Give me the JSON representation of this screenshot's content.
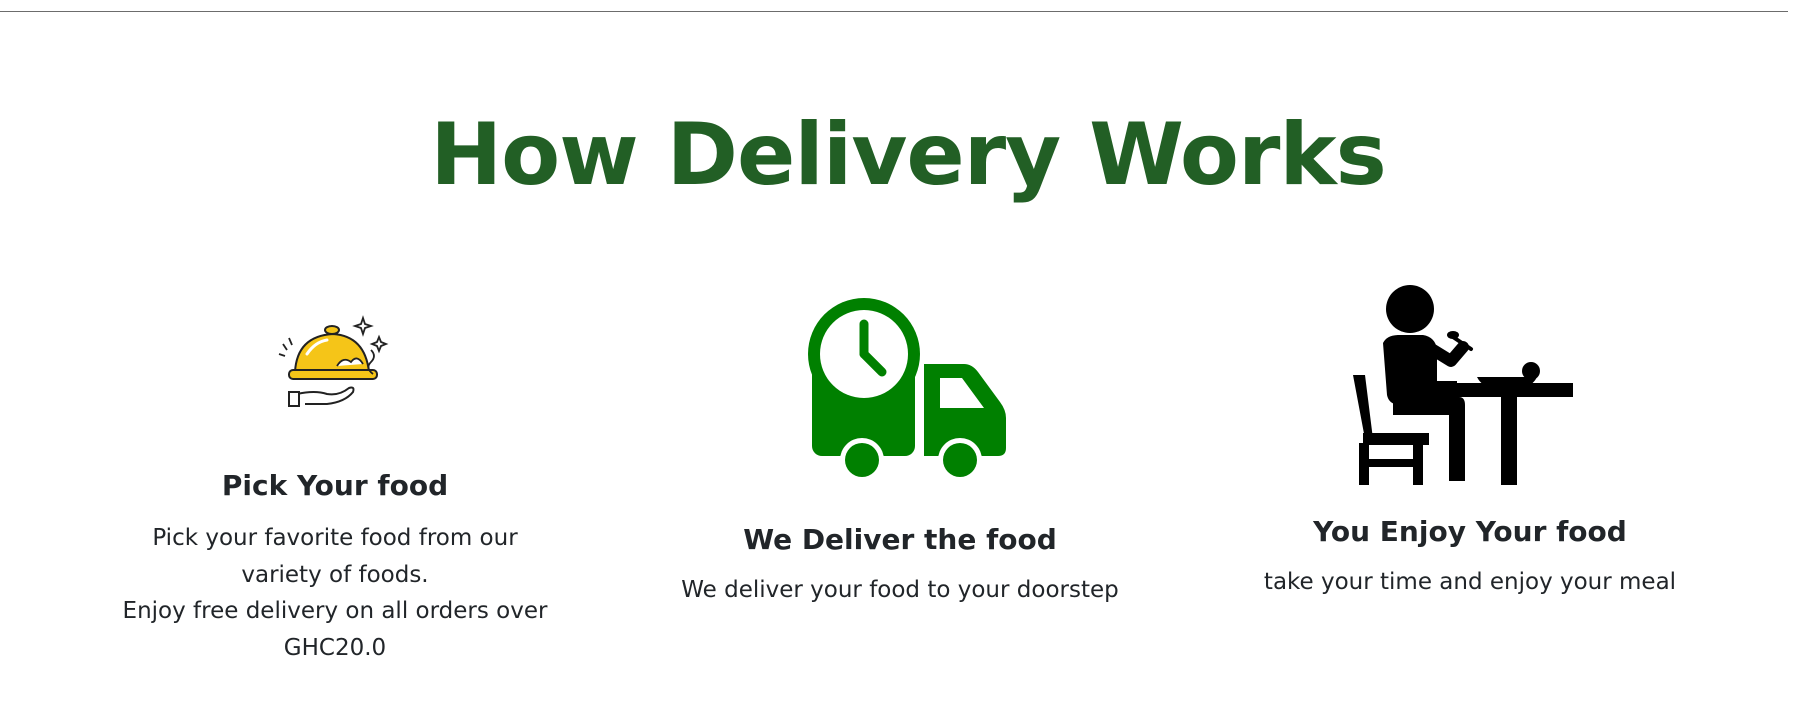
{
  "section": {
    "title": "How Delivery Works"
  },
  "steps": [
    {
      "icon": "serving-cloche-icon",
      "title": "Pick Your food",
      "lines": [
        "Pick your favorite food from our",
        "variety of foods.",
        "Enjoy free delivery on all orders over",
        "GHC20.0"
      ]
    },
    {
      "icon": "delivery-truck-clock-icon",
      "title": "We Deliver the food",
      "lines": [
        "We deliver your food to your doorstep"
      ]
    },
    {
      "icon": "person-eating-at-table-icon",
      "title": "You Enjoy Your food",
      "lines": [
        "take your time and enjoy your meal"
      ]
    }
  ],
  "colors": {
    "title": "#225f25",
    "truck": "#008000",
    "cloche": "#f5c518",
    "text": "#212529"
  }
}
